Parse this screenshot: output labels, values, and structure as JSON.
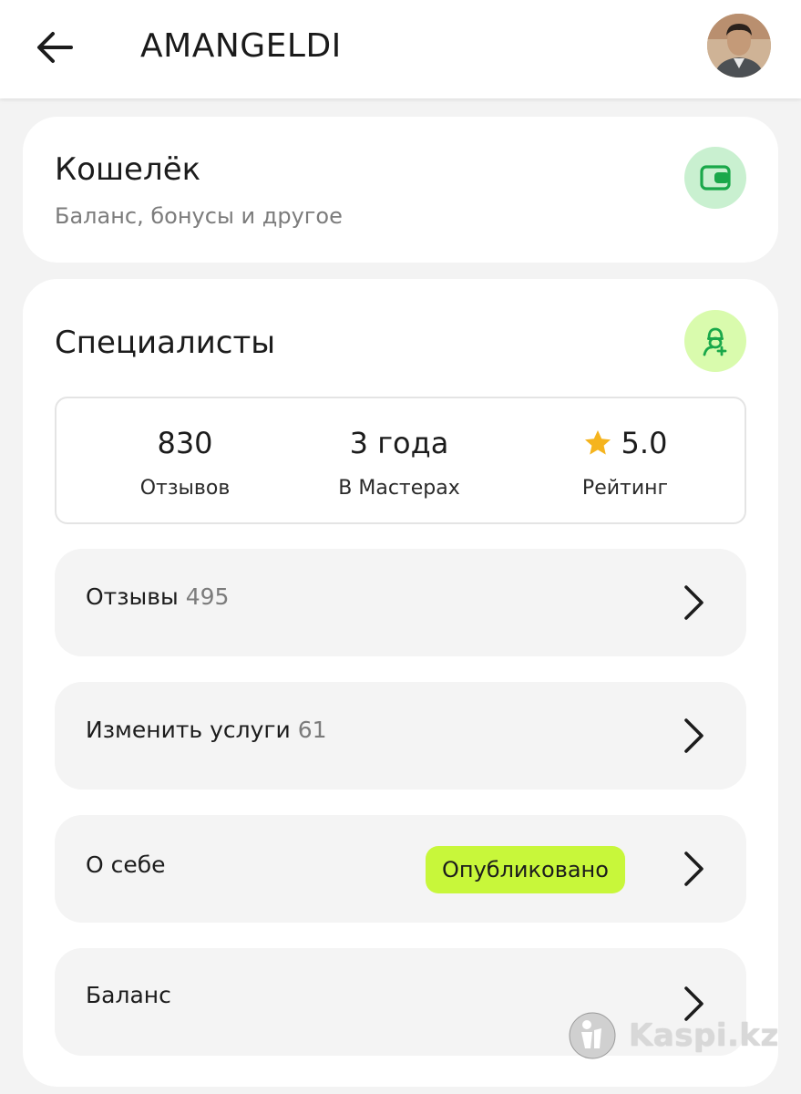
{
  "header": {
    "title": "AMANGELDI",
    "back_icon": "arrow-left-icon",
    "avatar_icon": "user-avatar"
  },
  "wallet": {
    "title": "Кошелёк",
    "subtitle": "Баланс, бонусы и другое",
    "icon": "wallet-icon",
    "icon_bg": "#c9f0d0",
    "icon_color": "#1aa84a"
  },
  "specialists": {
    "title": "Специалисты",
    "icon": "specialist-icon",
    "icon_bg": "#d9fbad",
    "stats": [
      {
        "value": "830",
        "label": "Отзывов"
      },
      {
        "value": "3 года",
        "label": "В Мастерах"
      },
      {
        "value": "5.0",
        "label": "Рейтинг",
        "icon": "star-icon",
        "icon_color": "#f5b41e"
      }
    ],
    "rows": [
      {
        "label": "Отзывы",
        "count": "495"
      },
      {
        "label": "Изменить услуги",
        "count": "61"
      },
      {
        "label": "О себе",
        "badge": "Опубликовано",
        "badge_color": "#c8f73a"
      },
      {
        "label": "Баланс"
      }
    ]
  },
  "watermark": {
    "text": "Kaspi.kz"
  }
}
